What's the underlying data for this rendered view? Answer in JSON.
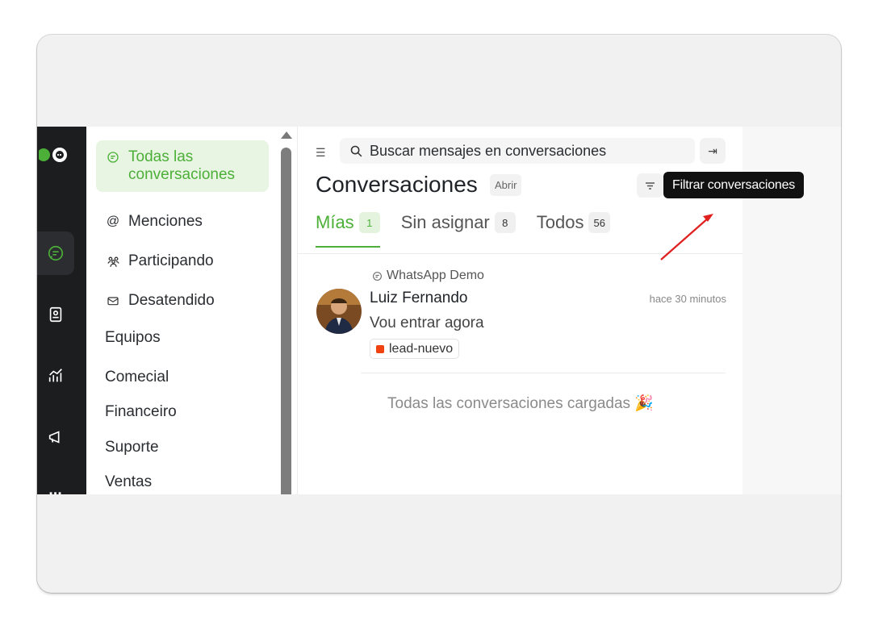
{
  "rail": {
    "items": [
      {
        "icon": "chat-icon",
        "active": true
      },
      {
        "icon": "contacts-icon",
        "active": false
      },
      {
        "icon": "reports-icon",
        "active": false
      },
      {
        "icon": "campaigns-icon",
        "active": false
      },
      {
        "icon": "more-icon",
        "active": false
      }
    ]
  },
  "sidebar": {
    "nav": [
      {
        "label": "Todas las conversaciones",
        "icon": "chat-bubble-icon"
      },
      {
        "label": "Menciones",
        "icon": "at-icon"
      },
      {
        "label": "Participando",
        "icon": "people-icon"
      },
      {
        "label": "Desatendido",
        "icon": "mail-icon"
      }
    ],
    "teams_title": "Equipos",
    "teams": [
      "Comecial",
      "Financeiro",
      "Suporte",
      "Ventas"
    ]
  },
  "conversations": {
    "search_placeholder": "Buscar mensajes en conversaciones",
    "title": "Conversaciones",
    "status": "Abrir",
    "tabs": [
      {
        "label": "Mías",
        "count": "1"
      },
      {
        "label": "Sin asignar",
        "count": "8"
      },
      {
        "label": "Todos",
        "count": "56"
      }
    ],
    "items": [
      {
        "inbox": "WhatsApp Demo",
        "contact": "Luiz Fernando",
        "time": "hace 30 minutos",
        "message": "Vou entrar agora",
        "label": "lead-nuevo",
        "label_color": "#f0410f"
      }
    ],
    "footer": "Todas las conversaciones cargadas 🎉"
  },
  "tooltip": "Filtrar conversaciones",
  "colors": {
    "accent": "#4caf38",
    "rail_bg": "#1c1d1f",
    "annotation_arrow": "#e0201f"
  }
}
